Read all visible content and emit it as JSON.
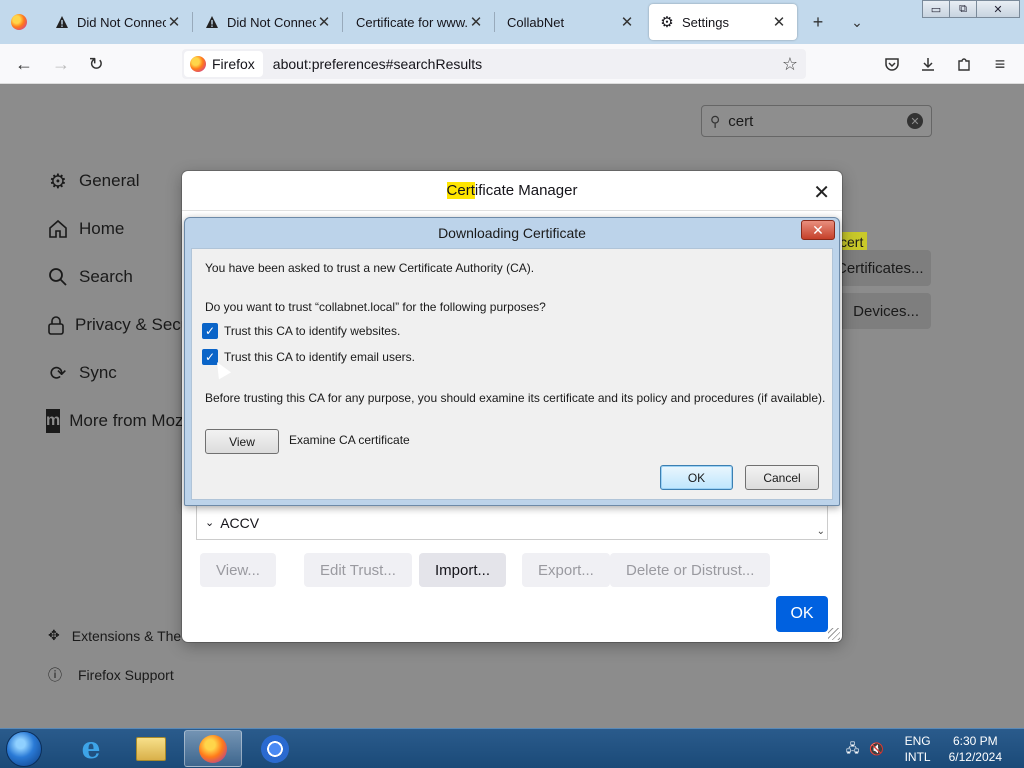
{
  "window_controls": {
    "minimize": "▭",
    "restore": "⧉",
    "close": "✕"
  },
  "tabs": [
    {
      "title": "Did Not Connect: Potential Security Issue",
      "icon": "warning-icon"
    },
    {
      "title": "Did Not Connect: Potential Security Issue",
      "icon": "warning-icon"
    },
    {
      "title": "Certificate for www.google.com",
      "icon": "none"
    },
    {
      "title": "CollabNet",
      "icon": "none"
    },
    {
      "title": "Settings",
      "icon": "gear-icon",
      "active": true
    }
  ],
  "urlbar": {
    "identity_label": "Firefox",
    "url": "about:preferences#searchResults"
  },
  "settings": {
    "search_value": "cert",
    "categories": [
      {
        "label": "General",
        "icon": "gear-icon"
      },
      {
        "label": "Home",
        "icon": "home-icon"
      },
      {
        "label": "Search",
        "icon": "search-icon"
      },
      {
        "label": "Privacy & Security",
        "icon": "lock-icon"
      },
      {
        "label": "Sync",
        "icon": "sync-icon"
      },
      {
        "label": "More from Mozilla",
        "icon": "mozilla-icon"
      }
    ],
    "footer": [
      {
        "label": "Extensions & Themes",
        "icon": "puzzle-icon"
      },
      {
        "label": "Firefox Support",
        "icon": "help-icon"
      }
    ],
    "bg_highlight": "cert",
    "bg_button_certificates": "Certificates...",
    "bg_button_devices": "Devices..."
  },
  "cert_manager": {
    "title_highlight": "Cert",
    "title_rest": "ificate Manager",
    "row_label": "ACCV",
    "buttons": {
      "view": "View...",
      "edit_trust": "Edit Trust...",
      "import": "Import...",
      "export": "Export...",
      "delete": "Delete or Distrust..."
    },
    "ok_label": "OK"
  },
  "download_cert": {
    "title": "Downloading Certificate",
    "intro": "You have been asked to trust a new Certificate Authority (CA).",
    "question": "Do you want to trust “collabnet.local” for the following purposes?",
    "check_websites": "Trust this CA to identify websites.",
    "check_email": "Trust this CA to identify email users.",
    "advice": "Before trusting this CA for any purpose, you should examine its certificate and its policy and procedures (if available).",
    "view_label": "View",
    "view_desc": "Examine CA certificate",
    "ok_label": "OK",
    "cancel_label": "Cancel"
  },
  "taskbar": {
    "lang_top": "ENG",
    "lang_bottom": "INTL",
    "time": "6:30 PM",
    "date": "6/12/2024"
  }
}
